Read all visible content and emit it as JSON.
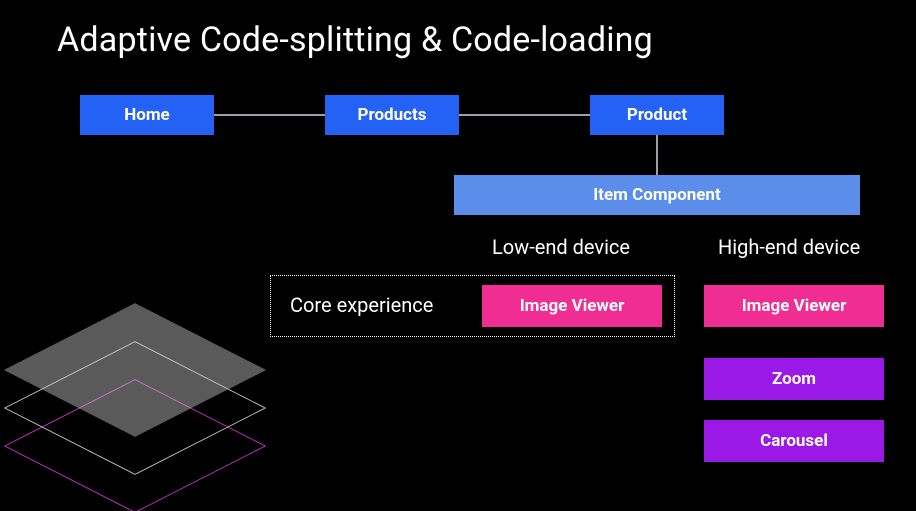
{
  "title": "Adaptive Code-splitting & Code-loading",
  "nav": {
    "home": "Home",
    "products": "Products",
    "product": "Product"
  },
  "component": "Item Component",
  "labels": {
    "low_end": "Low-end device",
    "high_end": "High-end device",
    "core": "Core experience"
  },
  "modules": {
    "low": {
      "viewer": "Image Viewer"
    },
    "high": {
      "viewer": "Image Viewer",
      "zoom": "Zoom",
      "carousel": "Carousel"
    }
  }
}
